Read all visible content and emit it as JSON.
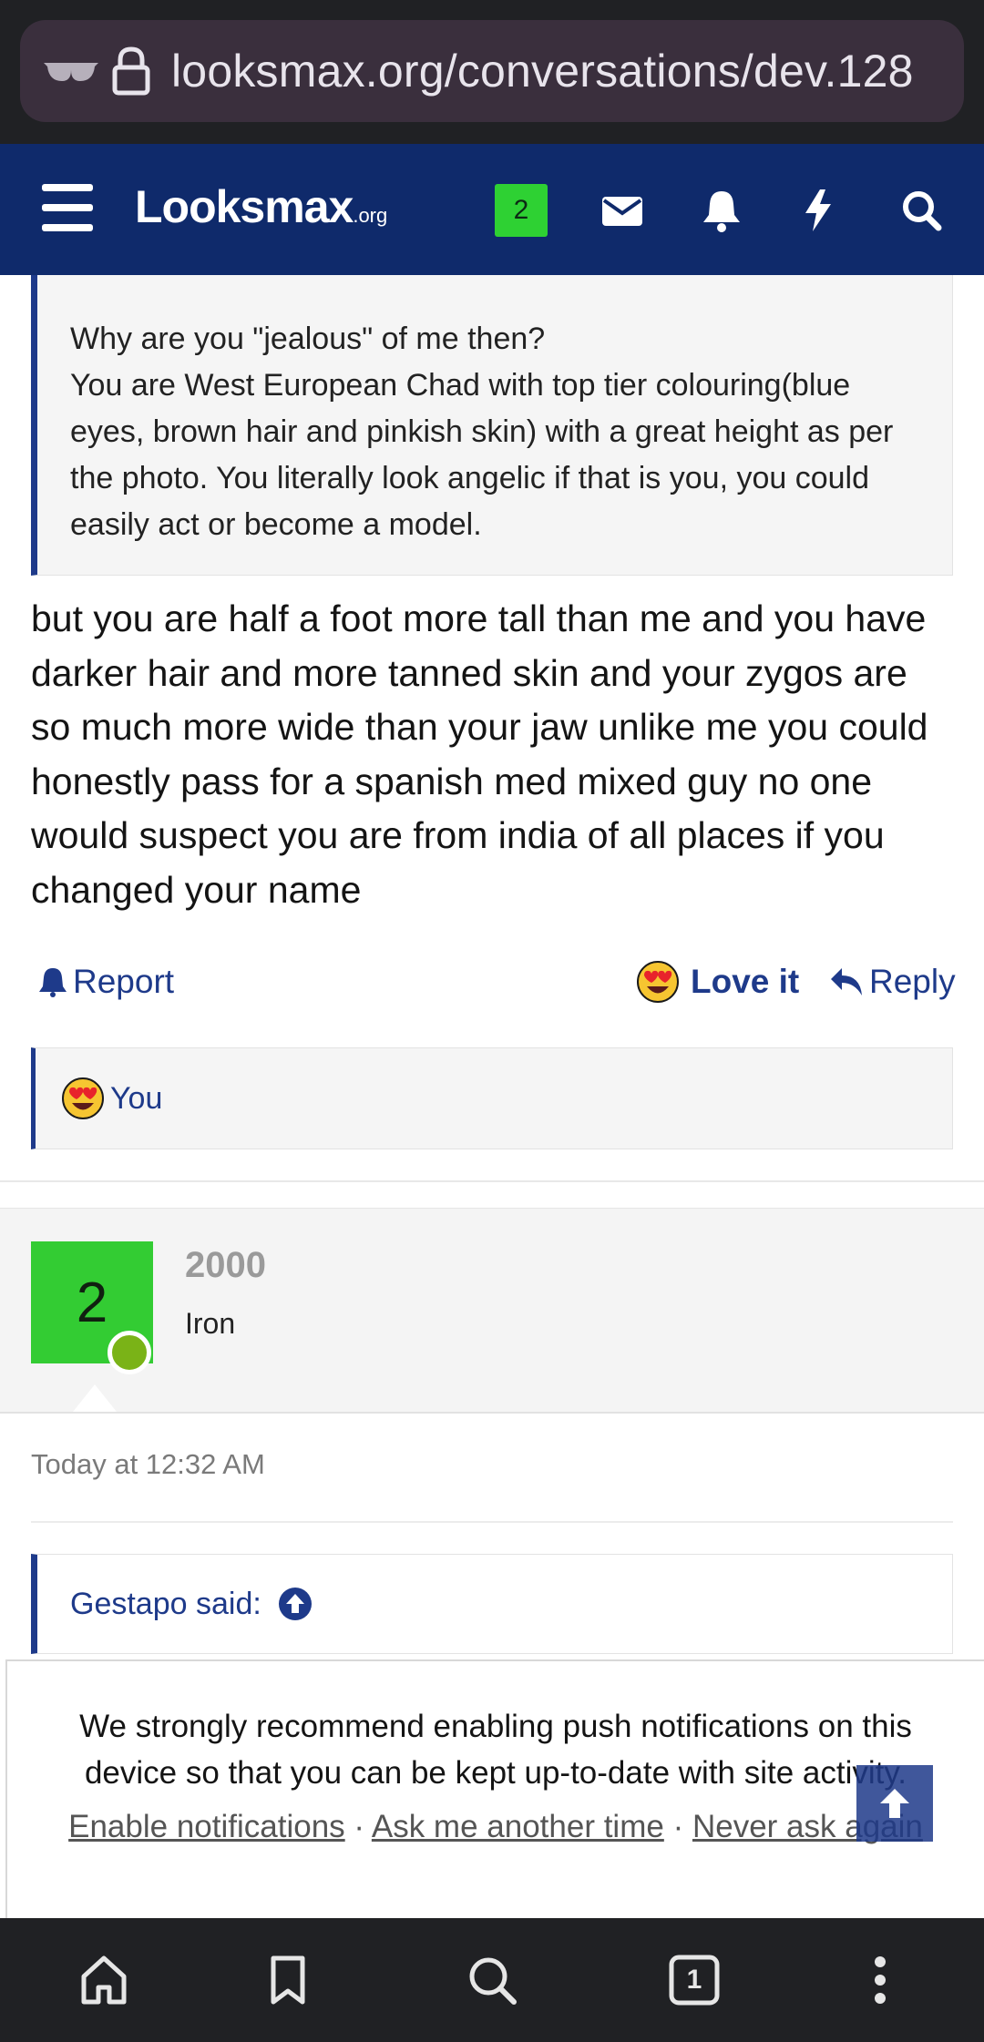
{
  "browser": {
    "url": "looksmax.org/conversations/dev.128",
    "tab_count": "1"
  },
  "header": {
    "logo_main": "Looksmax",
    "logo_suffix": ".org",
    "badge_count": "2"
  },
  "quote": {
    "lines": [
      "Why are you \"jealous\" of me then?",
      "You are West European Chad with top tier colouring(blue eyes, brown hair and pinkish skin) with a great height as per the photo. You literally look angelic if that is you, you could easily act or become a model."
    ]
  },
  "post": {
    "text": "but you are half a foot more tall than me and you have darker hair and more tanned skin and your zygos are so much more wide than your jaw unlike me you could honestly pass for a spanish med mixed guy no one would suspect you are from india of all places if you changed your name"
  },
  "actions": {
    "report": "Report",
    "love": "Love it",
    "reply": "Reply"
  },
  "reactions": {
    "by": "You"
  },
  "next_post": {
    "avatar_letter": "2",
    "username": "2000",
    "user_title": "Iron",
    "date": "Today at 12:32 AM",
    "quote_author": "Gestapo said:"
  },
  "push_notice": {
    "message": "We strongly recommend enabling push notifications on this device so that you can be kept up-to-date with site activity.",
    "enable": "Enable notifications",
    "later": "Ask me another time",
    "never": "Never ask again",
    "separator": "·"
  },
  "colors": {
    "header_bg": "#0f2a6b",
    "accent": "#1e3a8a",
    "badge_green": "#2ed133",
    "online_green": "#7ab317"
  }
}
